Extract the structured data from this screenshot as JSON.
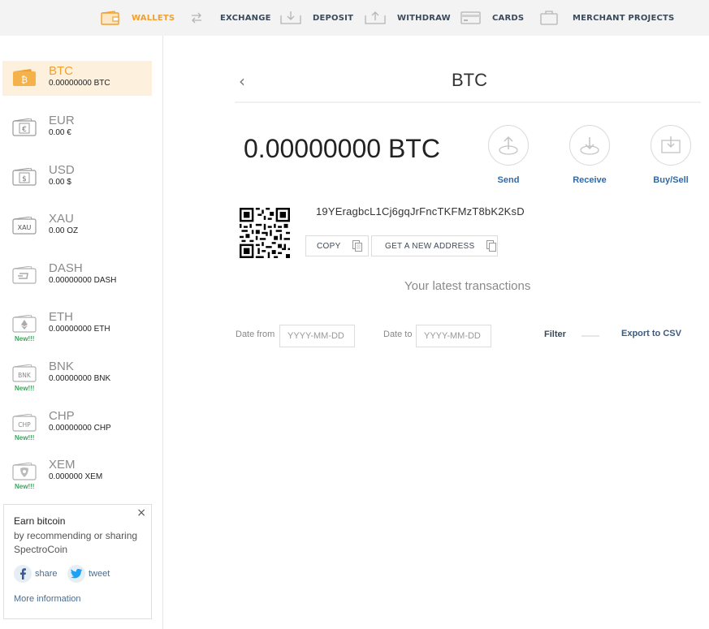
{
  "nav": {
    "items": [
      {
        "label": "WALLETS",
        "icon": "wallet-icon",
        "active": true
      },
      {
        "label": "EXCHANGE",
        "icon": "exchange-arrows-icon"
      },
      {
        "label": "DEPOSIT",
        "icon": "deposit-icon"
      },
      {
        "label": "WITHDRAW",
        "icon": "withdraw-icon"
      },
      {
        "label": "CARDS",
        "icon": "card-icon"
      },
      {
        "label": "MERCHANT PROJECTS",
        "icon": "briefcase-icon"
      }
    ]
  },
  "sidebar": {
    "wallets": [
      {
        "code": "BTC",
        "balance": "0.00000000 BTC",
        "symbol": "₿",
        "active": true
      },
      {
        "code": "EUR",
        "balance": "0.00 €",
        "symbol": "€"
      },
      {
        "code": "USD",
        "balance": "0.00 $",
        "symbol": "$"
      },
      {
        "code": "XAU",
        "balance": "0.00 OZ",
        "symbol": "XAU"
      },
      {
        "code": "DASH",
        "balance": "0.00000000 DASH",
        "symbol": "D"
      },
      {
        "code": "ETH",
        "balance": "0.00000000 ETH",
        "symbol": "◆",
        "badge": "New!!!"
      },
      {
        "code": "BNK",
        "balance": "0.00000000 BNK",
        "symbol": "BNK",
        "badge": "New!!!"
      },
      {
        "code": "CHP",
        "balance": "0.00000000 CHP",
        "symbol": "CHP",
        "badge": "New!!!"
      },
      {
        "code": "XEM",
        "balance": "0.000000 XEM",
        "symbol": "◈",
        "badge": "New!!!"
      }
    ],
    "promo": {
      "close": "×",
      "title": "Earn bitcoin",
      "text": "by recommending or sharing SpectroCoin",
      "share_label": "share",
      "tweet_label": "tweet",
      "more_label": "More information"
    }
  },
  "main": {
    "back": "‹",
    "title": "BTC",
    "balance": "0.00000000 BTC",
    "actions": [
      {
        "label": "Send",
        "icon": "send-icon"
      },
      {
        "label": "Receive",
        "icon": "receive-icon"
      },
      {
        "label": "Buy/Sell",
        "icon": "buy-sell-icon"
      }
    ],
    "address": "19YEragbcL1Cj6gqJrFncTKFMzT8bK2KsD",
    "copy_label": "COPY",
    "new_address_label": "GET A NEW ADDRESS",
    "latest_label": "Your latest transactions",
    "date_from_label": "Date from",
    "date_to_label": "Date to",
    "date_placeholder": "YYYY-MM-DD",
    "filter_label": "Filter",
    "export_label": "Export to CSV"
  },
  "colors": {
    "accent": "#f0a030",
    "active_bg": "#fdf0dc",
    "link": "#2f6aa8",
    "new_badge": "#3aa55a"
  }
}
